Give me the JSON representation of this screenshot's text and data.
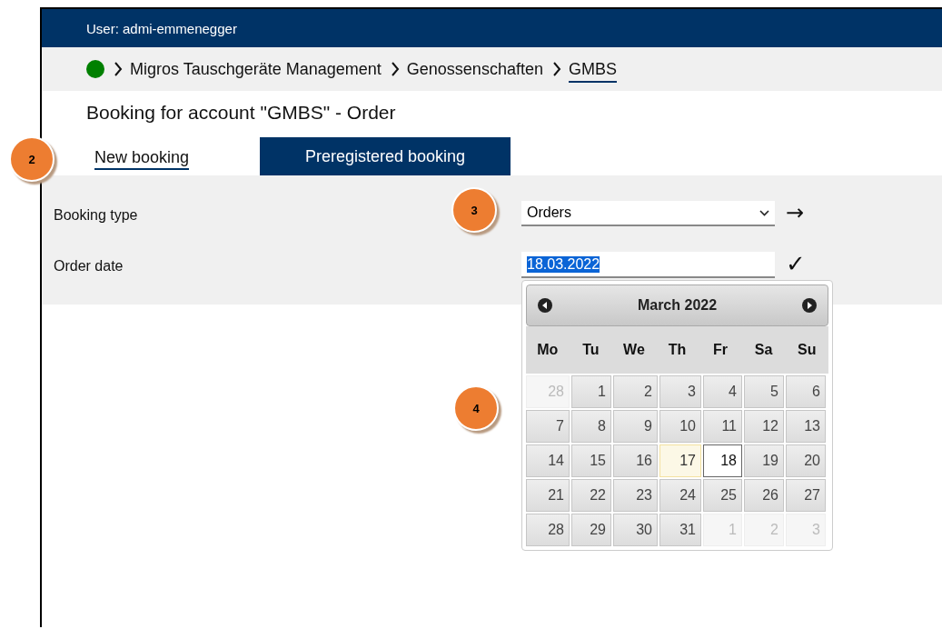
{
  "header": {
    "user": "User: admi-emmenegger"
  },
  "breadcrumb": {
    "items": [
      {
        "label": "Migros Tauschgeräte Management",
        "selected": false
      },
      {
        "label": "Genossenschaften",
        "selected": false
      },
      {
        "label": "GMBS",
        "selected": true
      }
    ]
  },
  "page_title": "Booking for account \"GMBS\" - Order",
  "tabs": [
    {
      "label": "New booking",
      "selected": true
    },
    {
      "label": "Preregistered booking",
      "selected": false
    }
  ],
  "form": [
    {
      "label": "Booking type",
      "kind": "select",
      "value": "Orders",
      "action": "→"
    },
    {
      "label": "Order date",
      "kind": "date",
      "value": "18.03.2022",
      "action": "✓"
    }
  ],
  "calendar": {
    "title": "March 2022",
    "weekdays": [
      "Mo",
      "Tu",
      "We",
      "Th",
      "Fr",
      "Sa",
      "Su"
    ],
    "weeks": [
      [
        {
          "day": "28",
          "kind": "other",
          "selected": false
        },
        {
          "day": "1",
          "kind": "current",
          "selected": false
        },
        {
          "day": "2",
          "kind": "current",
          "selected": false
        },
        {
          "day": "3",
          "kind": "current",
          "selected": false
        },
        {
          "day": "4",
          "kind": "current",
          "selected": false
        },
        {
          "day": "5",
          "kind": "current",
          "selected": false
        },
        {
          "day": "6",
          "kind": "current",
          "selected": false
        }
      ],
      [
        {
          "day": "7",
          "kind": "current",
          "selected": false
        },
        {
          "day": "8",
          "kind": "current",
          "selected": false
        },
        {
          "day": "9",
          "kind": "current",
          "selected": false
        },
        {
          "day": "10",
          "kind": "current",
          "selected": false
        },
        {
          "day": "11",
          "kind": "current",
          "selected": false
        },
        {
          "day": "12",
          "kind": "current",
          "selected": false
        },
        {
          "day": "13",
          "kind": "current",
          "selected": false
        }
      ],
      [
        {
          "day": "14",
          "kind": "current",
          "selected": false
        },
        {
          "day": "15",
          "kind": "current",
          "selected": false
        },
        {
          "day": "16",
          "kind": "current",
          "selected": false
        },
        {
          "day": "17",
          "kind": "today",
          "selected": false
        },
        {
          "day": "18",
          "kind": "current",
          "selected": true
        },
        {
          "day": "19",
          "kind": "current",
          "selected": false
        },
        {
          "day": "20",
          "kind": "current",
          "selected": false
        }
      ],
      [
        {
          "day": "21",
          "kind": "current",
          "selected": false
        },
        {
          "day": "22",
          "kind": "current",
          "selected": false
        },
        {
          "day": "23",
          "kind": "current",
          "selected": false
        },
        {
          "day": "24",
          "kind": "current",
          "selected": false
        },
        {
          "day": "25",
          "kind": "current",
          "selected": false
        },
        {
          "day": "26",
          "kind": "current",
          "selected": false
        },
        {
          "day": "27",
          "kind": "current",
          "selected": false
        }
      ],
      [
        {
          "day": "28",
          "kind": "current",
          "selected": false
        },
        {
          "day": "29",
          "kind": "current",
          "selected": false
        },
        {
          "day": "30",
          "kind": "current",
          "selected": false
        },
        {
          "day": "31",
          "kind": "current",
          "selected": false
        },
        {
          "day": "1",
          "kind": "other",
          "selected": false
        },
        {
          "day": "2",
          "kind": "other",
          "selected": false
        },
        {
          "day": "3",
          "kind": "other",
          "selected": false
        }
      ]
    ]
  },
  "callouts": [
    {
      "label": "2"
    },
    {
      "label": "3"
    },
    {
      "label": "4"
    }
  ]
}
